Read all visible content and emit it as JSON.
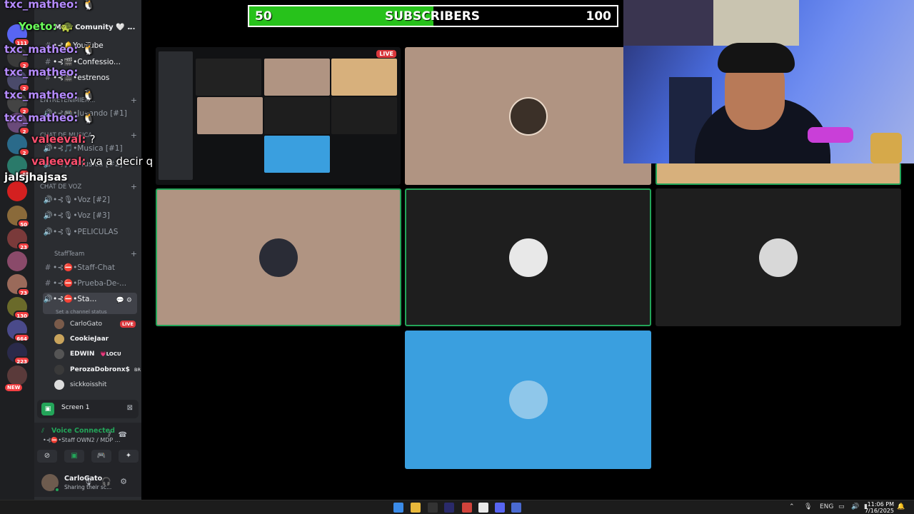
{
  "overlay": {
    "subscribers": {
      "label": "SUBSCRIBERS",
      "current": 50,
      "goal": 100,
      "progress": 0.5,
      "fill_color": "#27c21b"
    }
  },
  "chat": [
    {
      "user": "txc_matheo:",
      "text": "🐧",
      "color": "purple"
    },
    {
      "user": "Yoeto:",
      "text": "🐢",
      "color": "green"
    },
    {
      "user": "txc_matheo:",
      "text": "🐧",
      "color": "purple"
    },
    {
      "user": "txc_matheo:",
      "text": "",
      "color": "purple"
    },
    {
      "user": "txc_matheo:",
      "text": "🐧",
      "color": "purple"
    },
    {
      "user": "txc_matheo:",
      "text": "🐧",
      "color": "purple"
    },
    {
      "user": "valeeval:",
      "text": "?",
      "color": "red"
    },
    {
      "user": "valeeval:",
      "text": "va a decir q si es buena?",
      "color": "red"
    },
    {
      "user": "",
      "text": "jalsjhajsas",
      "color": "white"
    }
  ],
  "server": {
    "name": "MDP Comunity 🤍 ...",
    "channels": [
      {
        "label": "•⊰🔔YouTube",
        "type": "text"
      },
      {
        "label": "•⊰🎬•Confessio...",
        "type": "text"
      },
      {
        "label": "•⊰🎬•estrenos",
        "type": "text"
      }
    ],
    "cat_entretenimiento": "ENTRETENIMIEN...",
    "ch_jugando": "•⊰🎮•Jugando [#1]",
    "cat_musica": "CHAT DE MUSICA",
    "ch_musica1": "•⊰🎵•Musica [#1]",
    "ch_musica2": "•⊰🎵•Musica [#2]",
    "cat_voz": "CHAT DE VOZ",
    "ch_voz2": "•⊰🎙•Voz [#2]",
    "ch_voz3": "•⊰🎙•Voz [#3]",
    "ch_peliculas": "•⊰🎙•PELICULAS",
    "cat_staff": "StaffTeam",
    "ch_staffchat": "•⊰⛔•Staff-Chat",
    "ch_prueba": "•⊰⛔•Prueba-De-...",
    "ch_active": "•⊰⛔•Sta...",
    "ch_active_hint": "Set a channel status",
    "voice_users": [
      {
        "name": "CarloGato",
        "tag": "LIVE",
        "color": "#7a5b4a"
      },
      {
        "name": "CookieJaar",
        "tag": "",
        "color": "#c9a45c"
      },
      {
        "name": "EDWIN",
        "tag": "💗LOCU",
        "color": "#555"
      },
      {
        "name": "PerozaDobronx$",
        "tag": "BR",
        "color": "#3a3a3a"
      },
      {
        "name": "sickkoisshit",
        "tag": "",
        "color": "#ddd"
      }
    ]
  },
  "rail_badges": [
    "111",
    "2",
    "2",
    "2",
    "2",
    "2",
    "5",
    "2",
    "50",
    "23",
    "73",
    "130",
    "664",
    "223",
    "NEW"
  ],
  "screen_share": {
    "label": "Screen 1"
  },
  "voice": {
    "title": "Voice Connected",
    "subtitle": "•⊰⛔•Staff OWN2 / MDP ..."
  },
  "user": {
    "name": "CarloGato",
    "status": "Sharing their sc..."
  },
  "grid": {
    "live_label": "LIVE"
  },
  "taskbar": {
    "lang": "ENG",
    "time": "11:06 PM",
    "date": "7/16/2025"
  },
  "colors": {
    "tile_tan": "#b09482",
    "tile_gold": "#d7b07c",
    "tile_dark": "#1e1e1e",
    "tile_blue": "#3a9fdf",
    "speaking": "#23a559"
  }
}
